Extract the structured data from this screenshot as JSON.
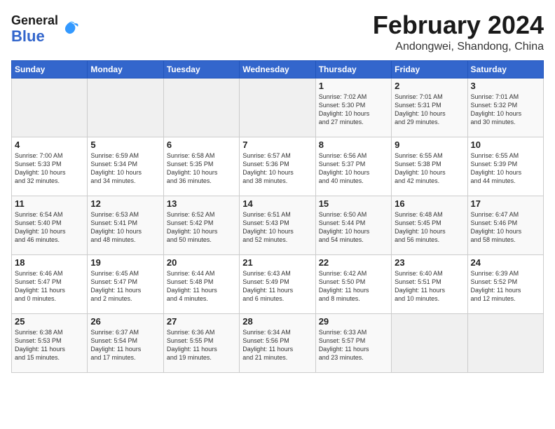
{
  "header": {
    "logo_general": "General",
    "logo_blue": "Blue",
    "title": "February 2024",
    "location": "Andongwei, Shandong, China"
  },
  "days_of_week": [
    "Sunday",
    "Monday",
    "Tuesday",
    "Wednesday",
    "Thursday",
    "Friday",
    "Saturday"
  ],
  "weeks": [
    [
      {
        "day": "",
        "info": ""
      },
      {
        "day": "",
        "info": ""
      },
      {
        "day": "",
        "info": ""
      },
      {
        "day": "",
        "info": ""
      },
      {
        "day": "1",
        "info": "Sunrise: 7:02 AM\nSunset: 5:30 PM\nDaylight: 10 hours\nand 27 minutes."
      },
      {
        "day": "2",
        "info": "Sunrise: 7:01 AM\nSunset: 5:31 PM\nDaylight: 10 hours\nand 29 minutes."
      },
      {
        "day": "3",
        "info": "Sunrise: 7:01 AM\nSunset: 5:32 PM\nDaylight: 10 hours\nand 30 minutes."
      }
    ],
    [
      {
        "day": "4",
        "info": "Sunrise: 7:00 AM\nSunset: 5:33 PM\nDaylight: 10 hours\nand 32 minutes."
      },
      {
        "day": "5",
        "info": "Sunrise: 6:59 AM\nSunset: 5:34 PM\nDaylight: 10 hours\nand 34 minutes."
      },
      {
        "day": "6",
        "info": "Sunrise: 6:58 AM\nSunset: 5:35 PM\nDaylight: 10 hours\nand 36 minutes."
      },
      {
        "day": "7",
        "info": "Sunrise: 6:57 AM\nSunset: 5:36 PM\nDaylight: 10 hours\nand 38 minutes."
      },
      {
        "day": "8",
        "info": "Sunrise: 6:56 AM\nSunset: 5:37 PM\nDaylight: 10 hours\nand 40 minutes."
      },
      {
        "day": "9",
        "info": "Sunrise: 6:55 AM\nSunset: 5:38 PM\nDaylight: 10 hours\nand 42 minutes."
      },
      {
        "day": "10",
        "info": "Sunrise: 6:55 AM\nSunset: 5:39 PM\nDaylight: 10 hours\nand 44 minutes."
      }
    ],
    [
      {
        "day": "11",
        "info": "Sunrise: 6:54 AM\nSunset: 5:40 PM\nDaylight: 10 hours\nand 46 minutes."
      },
      {
        "day": "12",
        "info": "Sunrise: 6:53 AM\nSunset: 5:41 PM\nDaylight: 10 hours\nand 48 minutes."
      },
      {
        "day": "13",
        "info": "Sunrise: 6:52 AM\nSunset: 5:42 PM\nDaylight: 10 hours\nand 50 minutes."
      },
      {
        "day": "14",
        "info": "Sunrise: 6:51 AM\nSunset: 5:43 PM\nDaylight: 10 hours\nand 52 minutes."
      },
      {
        "day": "15",
        "info": "Sunrise: 6:50 AM\nSunset: 5:44 PM\nDaylight: 10 hours\nand 54 minutes."
      },
      {
        "day": "16",
        "info": "Sunrise: 6:48 AM\nSunset: 5:45 PM\nDaylight: 10 hours\nand 56 minutes."
      },
      {
        "day": "17",
        "info": "Sunrise: 6:47 AM\nSunset: 5:46 PM\nDaylight: 10 hours\nand 58 minutes."
      }
    ],
    [
      {
        "day": "18",
        "info": "Sunrise: 6:46 AM\nSunset: 5:47 PM\nDaylight: 11 hours\nand 0 minutes."
      },
      {
        "day": "19",
        "info": "Sunrise: 6:45 AM\nSunset: 5:47 PM\nDaylight: 11 hours\nand 2 minutes."
      },
      {
        "day": "20",
        "info": "Sunrise: 6:44 AM\nSunset: 5:48 PM\nDaylight: 11 hours\nand 4 minutes."
      },
      {
        "day": "21",
        "info": "Sunrise: 6:43 AM\nSunset: 5:49 PM\nDaylight: 11 hours\nand 6 minutes."
      },
      {
        "day": "22",
        "info": "Sunrise: 6:42 AM\nSunset: 5:50 PM\nDaylight: 11 hours\nand 8 minutes."
      },
      {
        "day": "23",
        "info": "Sunrise: 6:40 AM\nSunset: 5:51 PM\nDaylight: 11 hours\nand 10 minutes."
      },
      {
        "day": "24",
        "info": "Sunrise: 6:39 AM\nSunset: 5:52 PM\nDaylight: 11 hours\nand 12 minutes."
      }
    ],
    [
      {
        "day": "25",
        "info": "Sunrise: 6:38 AM\nSunset: 5:53 PM\nDaylight: 11 hours\nand 15 minutes."
      },
      {
        "day": "26",
        "info": "Sunrise: 6:37 AM\nSunset: 5:54 PM\nDaylight: 11 hours\nand 17 minutes."
      },
      {
        "day": "27",
        "info": "Sunrise: 6:36 AM\nSunset: 5:55 PM\nDaylight: 11 hours\nand 19 minutes."
      },
      {
        "day": "28",
        "info": "Sunrise: 6:34 AM\nSunset: 5:56 PM\nDaylight: 11 hours\nand 21 minutes."
      },
      {
        "day": "29",
        "info": "Sunrise: 6:33 AM\nSunset: 5:57 PM\nDaylight: 11 hours\nand 23 minutes."
      },
      {
        "day": "",
        "info": ""
      },
      {
        "day": "",
        "info": ""
      }
    ]
  ]
}
